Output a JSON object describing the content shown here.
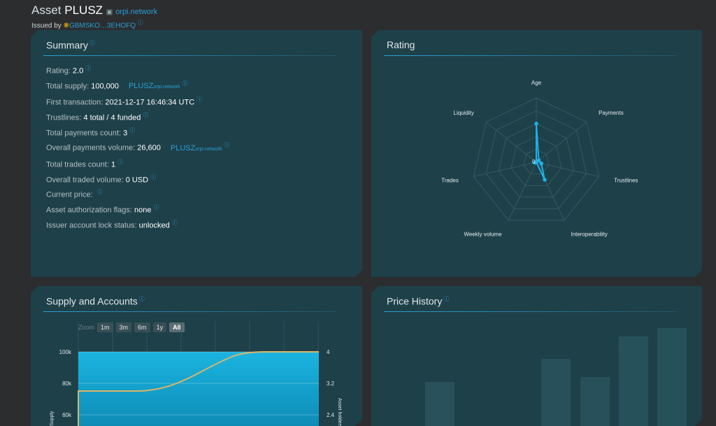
{
  "header": {
    "title_prefix": "Asset",
    "asset_code": "PLUSZ",
    "domain": "orpi.network",
    "issued_by_label": "Issued by",
    "issuer_account": "GBMSKO…3EHOFQ"
  },
  "summary": {
    "title": "Summary",
    "rows": [
      {
        "label": "Rating:",
        "value": "2.0"
      },
      {
        "label": "Total supply:",
        "value": "100,000",
        "currency": "PLUSZ",
        "currency_domain": "orpi.network"
      },
      {
        "label": "First transaction:",
        "value": "2021-12-17 16:46:34 UTC"
      },
      {
        "label": "Trustlines:",
        "value": "4 total / 4 funded"
      },
      {
        "label": "Total payments count:",
        "value": "3"
      },
      {
        "label": "Overall payments volume:",
        "value": "26,600",
        "currency": "PLUSZ",
        "currency_domain": "orpi.network"
      },
      {
        "label": "Total trades count:",
        "value": "1"
      },
      {
        "label": "Overall traded volume:",
        "value": "0 USD"
      },
      {
        "label": "Current price:",
        "value": ""
      },
      {
        "label": "Asset authorization flags:",
        "value": "none"
      },
      {
        "label": "Issuer account lock status:",
        "value": "unlocked"
      }
    ]
  },
  "rating": {
    "title": "Rating",
    "center_label": "0",
    "axes": [
      "Age",
      "Payments",
      "Trustlines",
      "Interoperability",
      "Weekly volume",
      "Trades",
      "Liquidity"
    ],
    "values": [
      0.6,
      0.05,
      0.08,
      0.3,
      0.0,
      0.02,
      0.0
    ]
  },
  "supply": {
    "title": "Supply and Accounts",
    "zoom_label": "Zoom",
    "zoom_options": [
      "1m",
      "3m",
      "6m",
      "1y",
      "All"
    ],
    "zoom_active": "All",
    "left_ticks": [
      "100k",
      "80k",
      "60k"
    ],
    "right_ticks": [
      "4",
      "3.2",
      "2.4"
    ],
    "left_axis_label": "Supply",
    "right_axis_label": "Asset holders"
  },
  "price": {
    "title": "Price History"
  },
  "colors": {
    "accent": "#2a9fd6",
    "panel": "#1e4049",
    "background": "#2b2d2f",
    "holders_line": "#d9b66a"
  }
}
